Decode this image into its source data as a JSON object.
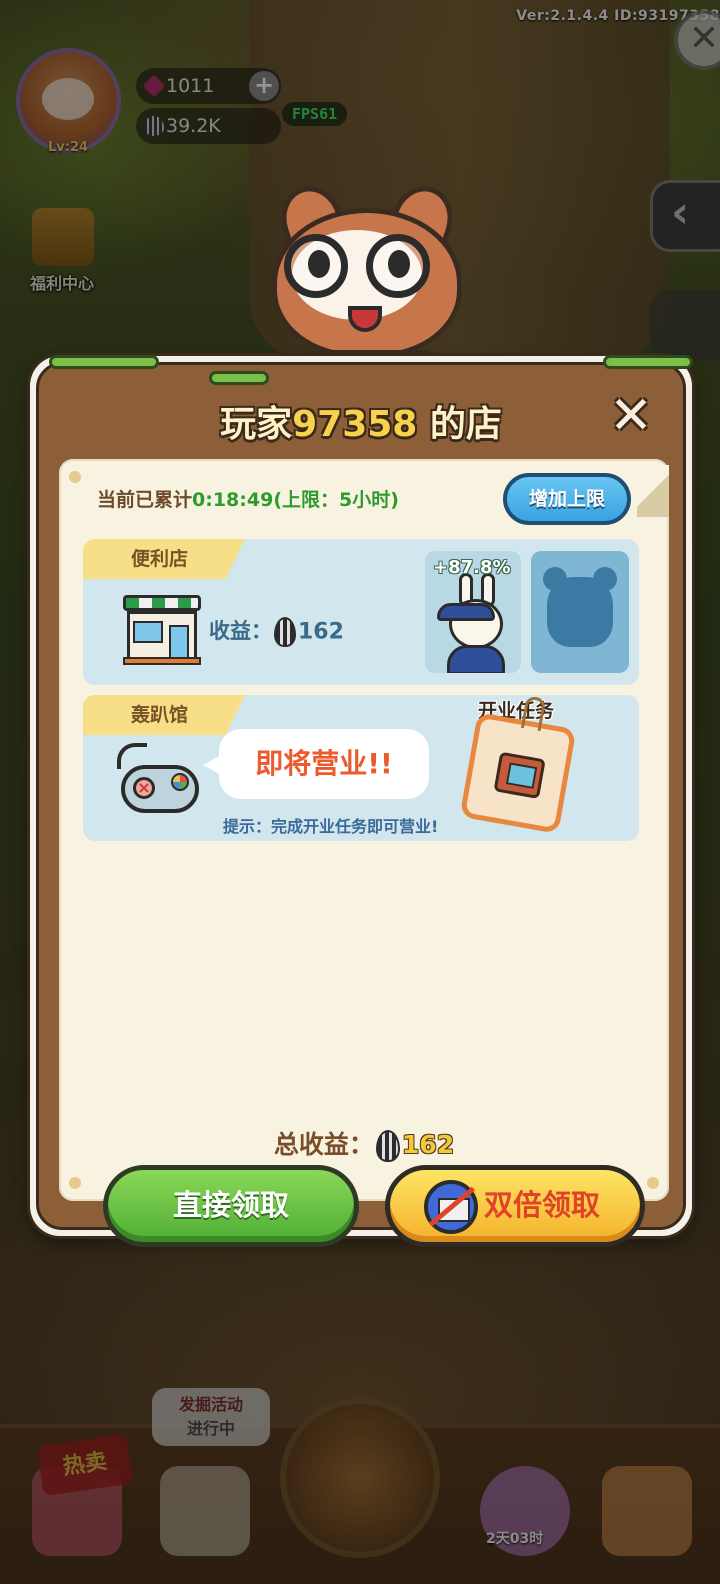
{
  "hud": {
    "version": "Ver:2.1.4.4 ID:93197358",
    "level": "Lv:24",
    "gems": "1011",
    "seeds": "39.2K",
    "fps": "FPS61",
    "welfare_label": "福利中心"
  },
  "dialog": {
    "title_prefix": "玩家",
    "player_id": "97358",
    "title_suffix": " 的店",
    "accum_label": "当前已累计",
    "accum_time": "0:18:49",
    "accum_limit": "(上限：5小时)",
    "increase_limit_label": "增加上限",
    "shops": [
      {
        "name": "便利店",
        "income_label": "收益：",
        "income_value": "162",
        "staff_bonus": "+87.8%"
      },
      {
        "name": "轰趴馆",
        "status": "即将营业!!",
        "hint": "提示：完成开业任务即可营业!"
      }
    ],
    "task_label": "开业任务",
    "total_label": "总收益：",
    "total_value": "162",
    "claim_direct_label": "直接领取",
    "claim_double_label": "双倍领取"
  },
  "bottom": {
    "hot_label": "热卖",
    "dig_line1": "发掘活动",
    "dig_line2": "进行中",
    "timer": "2天03时"
  },
  "colors": {
    "dialog_wood": "#8c5f38",
    "paper": "#f8f3e0",
    "card_blue": "#d2e6ee",
    "tag_yellow": "#f6df86",
    "green_button": "#4fae35",
    "yellow_button": "#f4b12a",
    "blue_button": "#3aa2e0",
    "time_green": "#2d9b2d",
    "status_orange": "#ec5a2e"
  }
}
